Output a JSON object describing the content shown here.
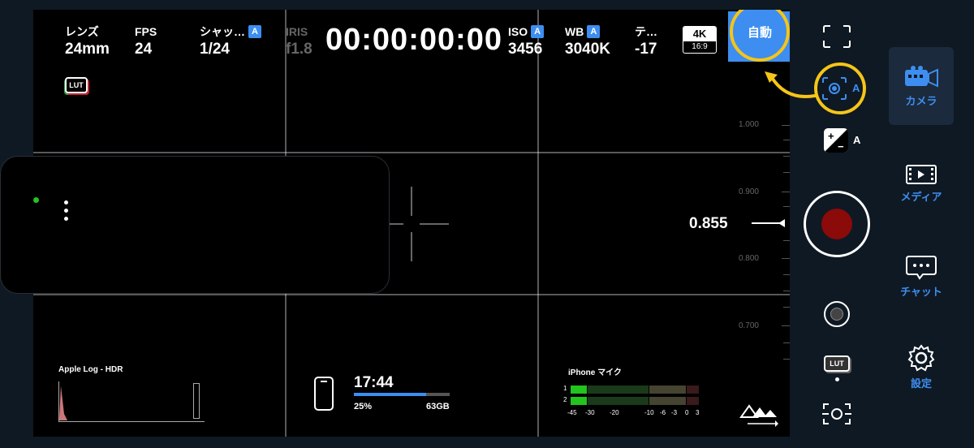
{
  "hud": {
    "lens": {
      "label": "レンズ",
      "value": "24mm"
    },
    "fps": {
      "label": "FPS",
      "value": "24"
    },
    "shutter": {
      "label": "シャッ…",
      "auto": "A",
      "value": "1/24"
    },
    "iris": {
      "label": "IRIS",
      "value": "f1.8"
    },
    "timecode": "00:00:00:00",
    "iso": {
      "label": "ISO",
      "auto": "A",
      "value": "3456"
    },
    "wb": {
      "label": "WB",
      "auto": "A",
      "value": "3040K"
    },
    "tint": {
      "label": "テ…",
      "value": "-17"
    },
    "resolution": {
      "top": "4K",
      "bottom": "16:9"
    },
    "auto_button": "自動",
    "lut_badge": "LUT"
  },
  "zoom": {
    "value_label": "0.855",
    "ticks": [
      "1.000",
      "0.900",
      "0.800",
      "0.700"
    ]
  },
  "bottom": {
    "log_label": "Apple Log - HDR",
    "storage": {
      "time": "17:44",
      "percent": "25%",
      "size": "63GB",
      "fill": 0.75
    },
    "mic_label": "iPhone マイク",
    "meter_channels": [
      "1",
      "2"
    ],
    "meter_scale": [
      "-45",
      "-30",
      "-20",
      "-10",
      "-6",
      "-3",
      "0",
      "3"
    ],
    "meter_levels": [
      0.08,
      0.08
    ]
  },
  "controls": {
    "exposure_auto": "A",
    "focus_auto": "A",
    "lut_label": "LUT"
  },
  "nav": {
    "items": [
      {
        "label": "カメラ",
        "icon": "camera-icon"
      },
      {
        "label": "メディア",
        "icon": "film-icon"
      },
      {
        "label": "チャット",
        "icon": "chat-icon"
      },
      {
        "label": "設定",
        "icon": "gear-icon"
      }
    ]
  },
  "colors": {
    "accent": "#3d8ef0",
    "highlight_ring": "#f5c518",
    "record": "#8b0a0a",
    "meter_green": "#22c41e"
  }
}
